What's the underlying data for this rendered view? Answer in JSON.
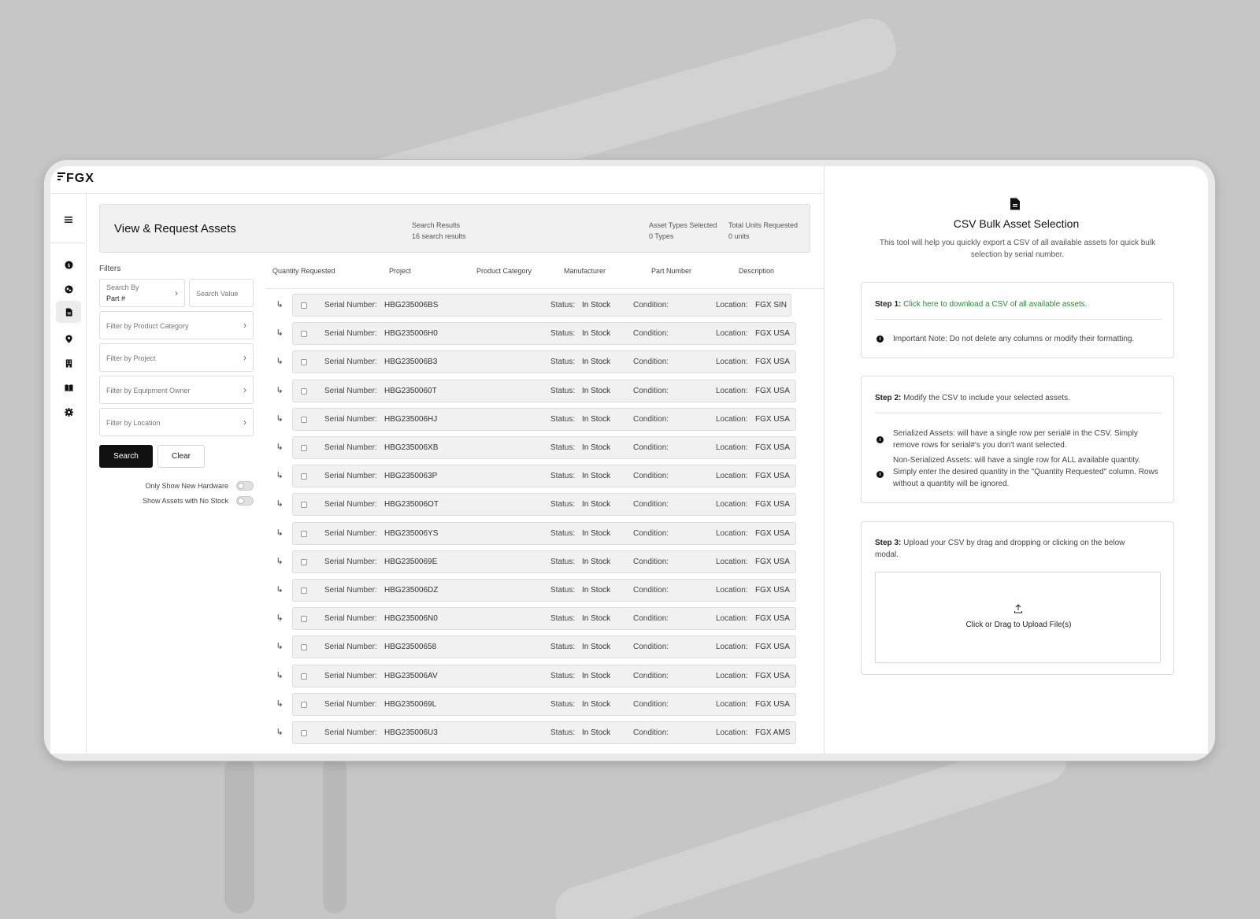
{
  "app": {
    "logo": "FGX"
  },
  "sidebar": {
    "items": [
      {
        "name": "menu-icon"
      },
      {
        "name": "dollar-icon"
      },
      {
        "name": "globe-icon"
      },
      {
        "name": "document-icon",
        "active": true
      },
      {
        "name": "location-pin-icon"
      },
      {
        "name": "building-icon"
      },
      {
        "name": "book-icon"
      },
      {
        "name": "gear-icon"
      }
    ]
  },
  "header": {
    "title": "View & Request Assets",
    "search_results_label": "Search Results",
    "search_results_value": "16 search results",
    "asset_types_label": "Asset Types Selected",
    "asset_types_value": "0 Types",
    "total_units_label": "Total Units Requested",
    "total_units_value": "0 units"
  },
  "filters": {
    "label": "Filters",
    "search_by_label": "Search By",
    "search_by_value": "Part #",
    "search_value_placeholder": "Search Value",
    "product_category": "Filter by Product Category",
    "project": "Filter by Project",
    "equipment_owner": "Filter by Equipment Owner",
    "location": "Filter by Location",
    "search_button": "Search",
    "clear_button": "Clear",
    "toggle_new_hardware": "Only Show New Hardware",
    "toggle_no_stock": "Show Assets with No Stock"
  },
  "table": {
    "columns": [
      "Quantity Requested",
      "Project",
      "Product Category",
      "Manufacturer",
      "Part Number",
      "Description"
    ],
    "serial_label": "Serial Number:",
    "status_label": "Status:",
    "condition_label": "Condition:",
    "location_label": "Location:",
    "rows": [
      {
        "serial": "HBG235006BS",
        "status": "In Stock",
        "location": "FGX SIN"
      },
      {
        "serial": "HBG235006H0",
        "status": "In Stock",
        "location": "FGX USA"
      },
      {
        "serial": "HBG235006B3",
        "status": "In Stock",
        "location": "FGX USA"
      },
      {
        "serial": "HBG2350060T",
        "status": "In Stock",
        "location": "FGX USA"
      },
      {
        "serial": "HBG235006HJ",
        "status": "In Stock",
        "location": "FGX USA"
      },
      {
        "serial": "HBG235006XB",
        "status": "In Stock",
        "location": "FGX USA"
      },
      {
        "serial": "HBG2350063P",
        "status": "In Stock",
        "location": "FGX USA"
      },
      {
        "serial": "HBG235006OT",
        "status": "In Stock",
        "location": "FGX USA"
      },
      {
        "serial": "HBG235006YS",
        "status": "In Stock",
        "location": "FGX USA"
      },
      {
        "serial": "HBG2350069E",
        "status": "In Stock",
        "location": "FGX USA"
      },
      {
        "serial": "HBG235006DZ",
        "status": "In Stock",
        "location": "FGX USA"
      },
      {
        "serial": "HBG235006N0",
        "status": "In Stock",
        "location": "FGX USA"
      },
      {
        "serial": "HBG23500658",
        "status": "In Stock",
        "location": "FGX USA"
      },
      {
        "serial": "HBG235006AV",
        "status": "In Stock",
        "location": "FGX USA"
      },
      {
        "serial": "HBG2350069L",
        "status": "In Stock",
        "location": "FGX USA"
      },
      {
        "serial": "HBG235006U3",
        "status": "In Stock",
        "location": "FGX AMS"
      }
    ]
  },
  "csv_panel": {
    "title": "CSV Bulk Asset Selection",
    "description": "This tool will help you quickly export a CSV of all available assets for quick bulk selection by serial number.",
    "step1_label": "Step 1:",
    "step1_link": "Click here to download a CSV of all available assets.",
    "step1_note": "Important Note: Do not delete any columns or modify their formatting.",
    "step2_label": "Step 2:",
    "step2_text": "Modify the CSV to include your selected assets.",
    "step2_serialized": "Serialized Assets: will have a single row per serial# in the CSV. Simply remove rows for serial#'s you don't want selected.",
    "step2_non_serialized": "Non-Serialized Assets: will have a single row for ALL available quantity. Simply enter the desired quantity in the \"Quantity Requested\" column. Rows without a quantity will be ignored.",
    "step3_label": "Step 3:",
    "step3_text": "Upload your CSV by drag and dropping or clicking on the below modal.",
    "upload_text": "Click or Drag to Upload File(s)"
  },
  "colors": {
    "link": "#2e8b3a",
    "primary_button": "#111111"
  }
}
